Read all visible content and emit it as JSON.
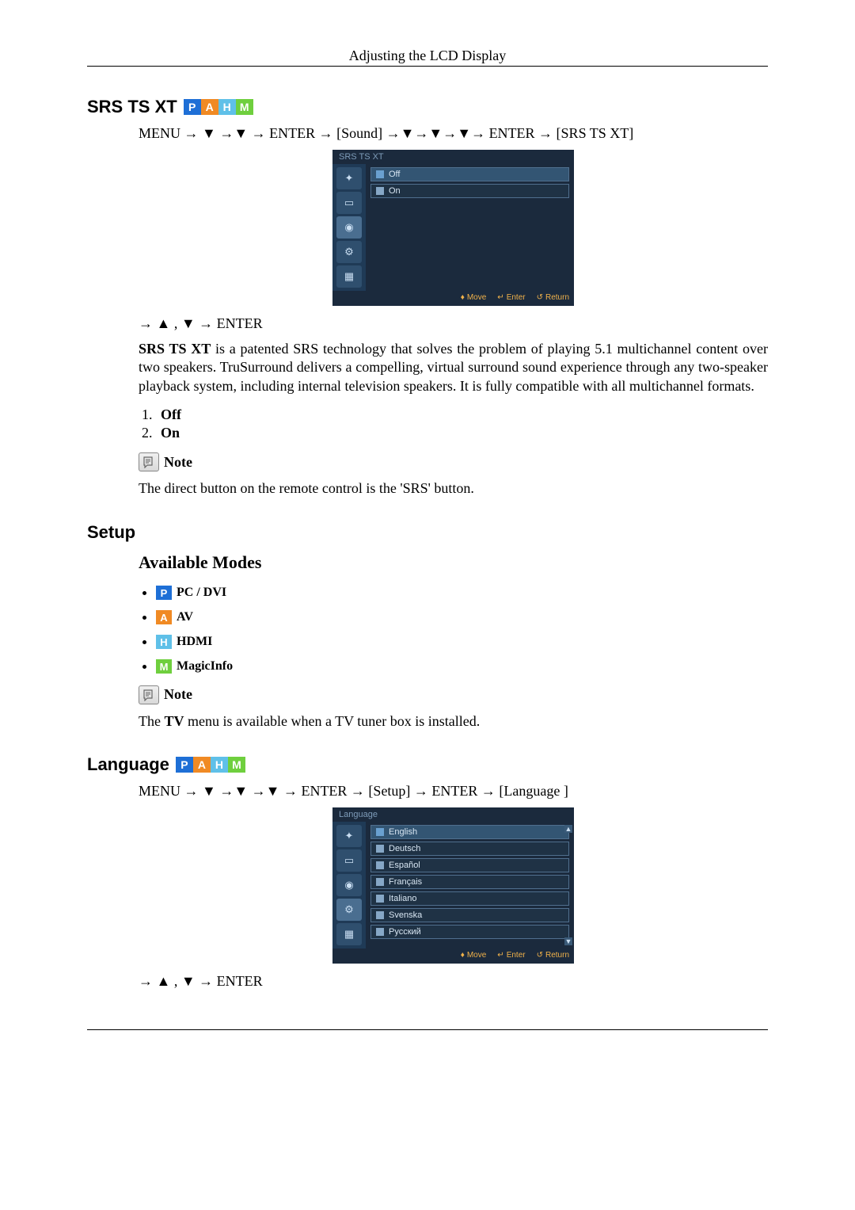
{
  "header": {
    "title": "Adjusting the LCD Display"
  },
  "badges": {
    "p": "P",
    "a": "A",
    "h": "H",
    "m": "M"
  },
  "srs": {
    "heading": "SRS TS XT",
    "nav_path": "MENU → ▼ →▼ → ENTER → [Sound] →▼→▼→▼→ ENTER → [SRS TS XT]",
    "osd": {
      "title": "SRS TS XT",
      "options": [
        "Off",
        "On"
      ],
      "footer": {
        "move": "Move",
        "enter": "Enter",
        "return": "Return"
      }
    },
    "after_nav": "→ ▲ , ▼ → ENTER",
    "desc_prefix_bold": "SRS TS XT",
    "desc_rest": " is a patented SRS technology that solves the problem of playing 5.1 multichannel content over two speakers. TruSurround delivers a compelling, virtual surround sound experience through any two-speaker playback system, including internal television speakers. It is fully compatible with all multichannel formats.",
    "list": {
      "item1": "Off",
      "item2": "On"
    },
    "note_label": "Note",
    "note_text": "The direct button on the remote control is the 'SRS' button."
  },
  "setup": {
    "heading": "Setup",
    "sub_heading": "Available Modes",
    "modes": {
      "pc": "PC / DVI",
      "av": "AV",
      "hdmi": "HDMI",
      "magicinfo": "MagicInfo"
    },
    "note_label": "Note",
    "note_text_before": "The ",
    "note_text_bold": "TV",
    "note_text_after": " menu is available when a TV tuner box is installed."
  },
  "language": {
    "heading": "Language",
    "nav_path": "MENU → ▼ →▼ →▼ → ENTER → [Setup] → ENTER → [Language ]",
    "osd": {
      "title": "Language",
      "options": [
        "English",
        "Deutsch",
        "Español",
        "Français",
        "Italiano",
        "Svenska",
        "Русский"
      ],
      "footer": {
        "move": "Move",
        "enter": "Enter",
        "return": "Return"
      }
    },
    "after_nav": "→ ▲ , ▼ → ENTER"
  }
}
